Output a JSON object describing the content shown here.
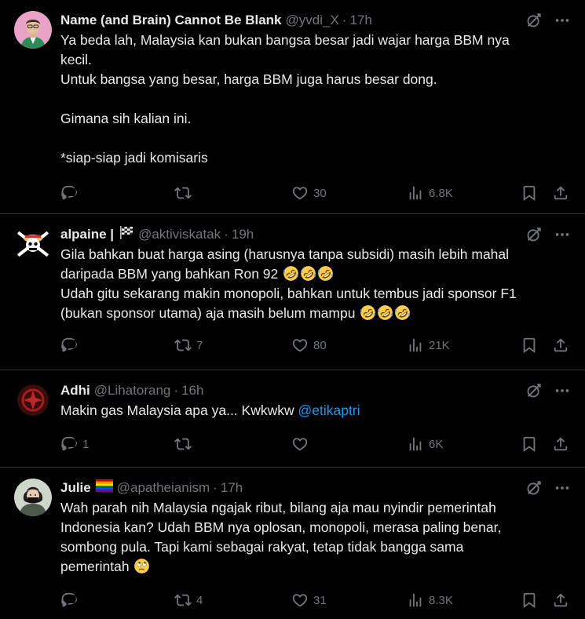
{
  "tweets": [
    {
      "name": "Name (and Brain) Cannot Be Blank",
      "handle": "@yvdi_X",
      "separator": "·",
      "time": "17h",
      "lines": [
        "Ya beda lah, Malaysia kan bukan bangsa besar jadi wajar harga BBM nya",
        "kecil.",
        "Untuk bangsa yang besar, harga BBM juga harus besar dong.",
        "",
        "Gimana sih kalian ini.",
        "",
        "*siap-siap jadi komisaris"
      ],
      "replies": "",
      "reposts": "",
      "likes": "30",
      "views": "6.8K"
    },
    {
      "name": "alpaine |",
      "handle": "@aktiviskatak",
      "separator": "·",
      "time": "19h",
      "line1": "Gila bahkan buat harga asing (harusnya tanpa subsidi) masih lebih mahal",
      "line2": "daripada BBM yang bahkan Ron 92",
      "line3": "Udah gitu sekarang makin monopoli, bahkan untuk tembus jadi sponsor F1",
      "line4": "(bukan sponsor utama) aja masih belum mampu",
      "emoji": "rolling-on-floor-laughing",
      "replies": "",
      "reposts": "7",
      "likes": "80",
      "views": "21K"
    },
    {
      "name": "Adhi",
      "handle": "@Lihatorang",
      "separator": "·",
      "time": "16h",
      "text": "Makin gas Malaysia apa ya... Kwkwkw",
      "mention": "@etikaptri",
      "replies": "1",
      "reposts": "",
      "likes": "",
      "views": "6K"
    },
    {
      "name": "Julie",
      "handle": "@apatheianism",
      "separator": "·",
      "time": "17h",
      "lines": [
        "Wah parah nih Malaysia ngajak ribut, bilang aja mau nyindir pemerintah",
        "Indonesia kan? Udah BBM nya oplosan, monopoli, merasa paling benar,",
        "sombong pula. Tapi kami sebagai rakyat, tetap tidak bangga sama",
        "pemerintah"
      ],
      "emoji": "face-with-rolling-eyes",
      "replies": "",
      "reposts": "4",
      "likes": "31",
      "views": "8.3K"
    }
  ],
  "colors": {
    "background": "#000000",
    "text": "#e7e9ea",
    "muted": "#71767b",
    "link": "#1d9bf0",
    "divider": "#2f3336"
  }
}
